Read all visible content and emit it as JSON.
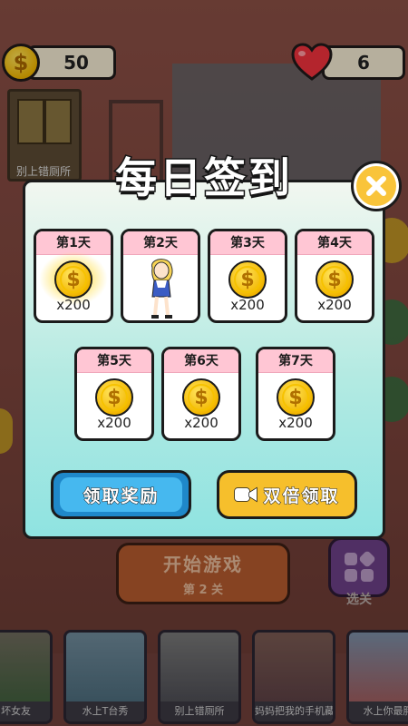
{
  "hud": {
    "coins": "50",
    "lives": "6"
  },
  "background": {
    "door_label": "别上错厕所",
    "start_button": {
      "label": "开始游戏",
      "level": "第 2 关"
    },
    "level_select_label": "选关",
    "bottom_cards": [
      "和坏女友",
      "水上T台秀",
      "别上错厕所",
      "妈妈把我的手机藏起来",
      "水上你最胖"
    ]
  },
  "dialog": {
    "title": "每日签到",
    "days": [
      {
        "label": "第1天",
        "reward": "x200",
        "type": "coin",
        "state": "current"
      },
      {
        "label": "第2天",
        "reward": "",
        "type": "character",
        "state": "available"
      },
      {
        "label": "第3天",
        "reward": "x200",
        "type": "coin",
        "state": "available"
      },
      {
        "label": "第4天",
        "reward": "x200",
        "type": "coin",
        "state": "available"
      },
      {
        "label": "第5天",
        "reward": "x200",
        "type": "coin",
        "state": "available"
      },
      {
        "label": "第6天",
        "reward": "x200",
        "type": "coin",
        "state": "available"
      },
      {
        "label": "第7天",
        "reward": "x200",
        "type": "coin",
        "state": "available"
      }
    ],
    "claim_button": "领取奖励",
    "double_button": "双倍领取"
  },
  "colors": {
    "dialog_top": "#f2f7f0",
    "dialog_bottom": "#8fe3e1",
    "day_header": "#ffc6d4",
    "claim_button": "#46b8ef",
    "double_button": "#f6bf2c",
    "coin": "#f2b600"
  }
}
